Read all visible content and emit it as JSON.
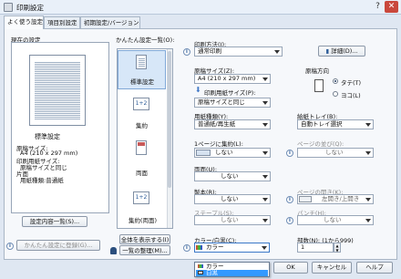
{
  "window": {
    "title": "印刷設定"
  },
  "tabs": [
    "よく使う設定",
    "項目別設定",
    "初期設定/バージョン"
  ],
  "left": {
    "heading": "現在の設定",
    "preset_name": "標準設定",
    "summary": [
      "原稿サイズ:",
      "A4 (210 x 297 mm)",
      "印刷用紙サイズ:",
      "原稿サイズと同じ",
      "片面",
      "用紙種類:普通紙"
    ],
    "details_button": "設定内容一覧(S)...",
    "register_button": "かんたん設定に登録(G)..."
  },
  "presets": {
    "label": "かんたん設定一覧(O):",
    "items": [
      "標準設定",
      "集約",
      "両面",
      "集約(両面)"
    ],
    "show_all_button": "全体を表示する(I)",
    "manage_button": "一覧の整理(M)..."
  },
  "print_method": {
    "label": "印刷方法(J):",
    "value": "通常印刷",
    "details_button": "詳細(D)..."
  },
  "paper_size": {
    "label": "原稿サイズ(Z):",
    "value": "A4 (210 x 297 mm)"
  },
  "print_paper_size": {
    "label": "印刷用紙サイズ(P):",
    "value": "原稿サイズと同じ"
  },
  "orientation": {
    "label": "原稿方向",
    "options": [
      "タテ(T)",
      "ヨコ(L)"
    ],
    "selected": 0
  },
  "paper_type": {
    "label": "用紙種類(Y):",
    "value": "普通紙/再生紙"
  },
  "tray": {
    "label": "給紙トレイ(B):",
    "value": "自動トレイ選択"
  },
  "layout": {
    "label": "1ページに集約(L):",
    "value": "しない"
  },
  "page_order": {
    "label": "ページの並び(Q):",
    "value": "しない"
  },
  "duplex": {
    "label": "両面(U):",
    "value": "しない"
  },
  "collate": {
    "label": "製本(R):",
    "value": "しない"
  },
  "page_layout": {
    "label": "ページの開き(K):",
    "value": "左開き/上開き"
  },
  "staple": {
    "label": "ステープル(S):",
    "value": "しない"
  },
  "punch": {
    "label": "パンチ(H):",
    "value": "しない"
  },
  "color": {
    "label": "カラー/白黒(C):",
    "value": "カラー",
    "options": [
      "カラー",
      "白黒"
    ],
    "highlighted": 1
  },
  "copies": {
    "label": "部数(N): (1から999)",
    "value": "1"
  },
  "footer": {
    "ok": "OK",
    "cancel": "キャンセル",
    "help": "ヘルプ"
  },
  "colors": {
    "accent": "#3399ff",
    "window_bg": "#dfe7f2"
  }
}
